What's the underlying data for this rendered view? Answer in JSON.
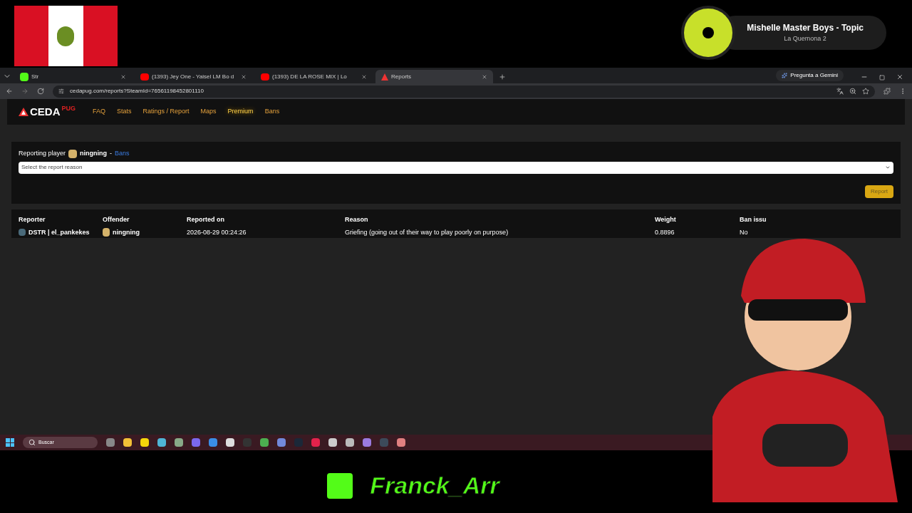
{
  "now_playing": {
    "title": "Mishelle Master Boys - Topic",
    "subtitle": "La Quemona 2"
  },
  "browser": {
    "tabs": [
      {
        "label": "Str",
        "selected": false,
        "kind": "kick"
      },
      {
        "label": "(1393) Jey One - Yaisel LM Bo d",
        "selected": false,
        "kind": "youtube"
      },
      {
        "label": "(1393) DE LA ROSE MIX | Lo",
        "selected": false,
        "kind": "youtube"
      },
      {
        "label": "Reports",
        "selected": true,
        "kind": "site"
      }
    ],
    "gemini": "Pregunta a Gemini",
    "url": "cedapug.com/reports?SteamId=76561198452801110"
  },
  "site": {
    "logo": "CEDA",
    "logo_suffix": "PUG",
    "nav": [
      {
        "label": "FAQ",
        "highlighted": false
      },
      {
        "label": "Stats",
        "highlighted": false
      },
      {
        "label": "Ratings / Report",
        "highlighted": false
      },
      {
        "label": "Maps",
        "highlighted": false
      },
      {
        "label": "Premium",
        "highlighted": true
      },
      {
        "label": "Bans",
        "highlighted": false
      }
    ]
  },
  "report_form": {
    "label": "Reporting player",
    "player": "ningning",
    "separator": "-",
    "bans_link": "Bans",
    "select_placeholder": "Select the report reason",
    "button": "Report"
  },
  "table": {
    "columns": [
      "Reporter",
      "Offender",
      "Reported on",
      "Reason",
      "Weight",
      "Ban issu"
    ],
    "rows": [
      {
        "reporter": "DSTR | el_pankekes",
        "offender": "ningning",
        "reported_on": "2026-08-29 00:24:26",
        "reason": "Griefing (going out of their way to play poorly on purpose)",
        "weight": "0.8896",
        "ban_issued": "No"
      }
    ]
  },
  "taskbar": {
    "search": "Buscar"
  },
  "streamer": {
    "name": "Franck_Arr"
  }
}
